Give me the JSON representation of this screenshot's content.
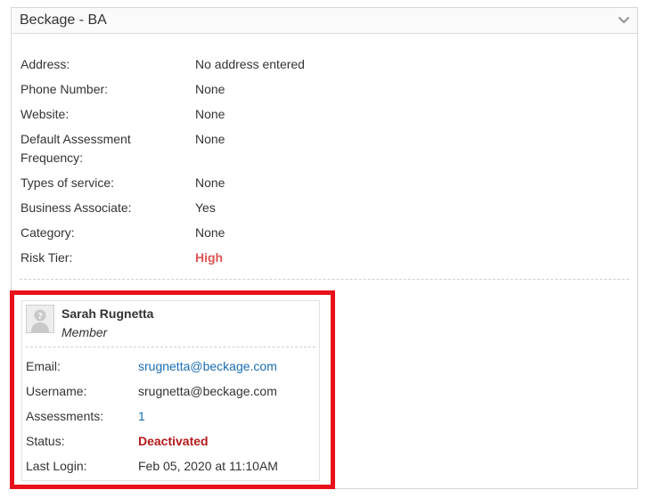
{
  "panel": {
    "title": "Beckage - BA",
    "toggle_icon": "chevron-down-icon"
  },
  "details": [
    {
      "label": "Address:",
      "value": "No address entered"
    },
    {
      "label": "Phone Number:",
      "value": "None"
    },
    {
      "label": "Website:",
      "value": "None"
    },
    {
      "label": "Default Assessment Frequency:",
      "value": "None"
    },
    {
      "label": "Types of service:",
      "value": "None"
    },
    {
      "label": "Business Associate:",
      "value": "Yes"
    },
    {
      "label": "Category:",
      "value": "None"
    },
    {
      "label": "Risk Tier:",
      "value": "High"
    }
  ],
  "user": {
    "name": "Sarah Rugnetta",
    "role": "Member",
    "avatar_icon": "user-placeholder-icon",
    "fields": [
      {
        "label": "Email:",
        "value": "srugnetta@beckage.com"
      },
      {
        "label": "Username:",
        "value": "srugnetta@beckage.com"
      },
      {
        "label": "Assessments:",
        "value": "1"
      },
      {
        "label": "Status:",
        "value": "Deactivated"
      },
      {
        "label": "Last Login:",
        "value": "Feb 05, 2020 at 11:10AM"
      }
    ]
  },
  "colors": {
    "risk_high": "#e05555",
    "status_deactivated": "#b31b1b",
    "link": "#1a6db3",
    "highlight_border": "#e8101a"
  }
}
